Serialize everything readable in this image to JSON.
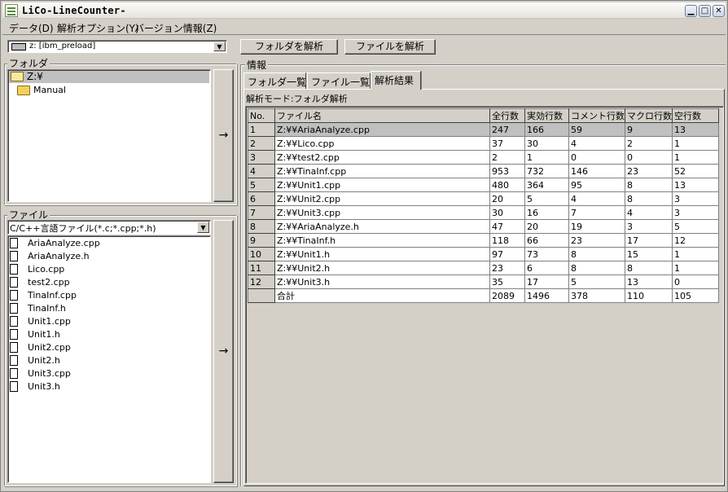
{
  "window": {
    "title": "LiCo-LineCounter-",
    "buttons": {
      "minimize": "▁",
      "maximize": "□",
      "close": "✕"
    }
  },
  "menu": [
    "データ(D)",
    "解析オプション(Y)",
    "バージョン情報(Z)"
  ],
  "drive": {
    "selected": "z: [ibm_preload]"
  },
  "actions": {
    "analyze_folder": "フォルダを解析",
    "analyze_file": "ファイルを解析",
    "move_arrow": "→"
  },
  "folder_panel": {
    "label": "フォルダ",
    "items": [
      "Z:¥",
      "Manual"
    ]
  },
  "file_panel": {
    "label": "ファイル",
    "filter": "C/C++言語ファイル(*.c;*.cpp;*.h)",
    "files": [
      "AriaAnalyze.cpp",
      "AriaAnalyze.h",
      "Lico.cpp",
      "test2.cpp",
      "TinaInf.cpp",
      "TinaInf.h",
      "Unit1.cpp",
      "Unit1.h",
      "Unit2.cpp",
      "Unit2.h",
      "Unit3.cpp",
      "Unit3.h"
    ]
  },
  "info": {
    "label": "情報",
    "tabs": [
      "フォルダ一覧",
      "ファイル一覧",
      "解析結果"
    ],
    "active_tab": 2,
    "mode_label": "解析モード:フォルダ解析"
  },
  "results": {
    "columns": [
      "No.",
      "ファイル名",
      "全行数",
      "実効行数",
      "コメント行数",
      "マクロ行数",
      "空行数"
    ],
    "rows": [
      [
        "1",
        "Z:¥¥AriaAnalyze.cpp",
        "247",
        "166",
        "59",
        "9",
        "13"
      ],
      [
        "2",
        "Z:¥¥Lico.cpp",
        "37",
        "30",
        "4",
        "2",
        "1"
      ],
      [
        "3",
        "Z:¥¥test2.cpp",
        "2",
        "1",
        "0",
        "0",
        "1"
      ],
      [
        "4",
        "Z:¥¥TinaInf.cpp",
        "953",
        "732",
        "146",
        "23",
        "52"
      ],
      [
        "5",
        "Z:¥¥Unit1.cpp",
        "480",
        "364",
        "95",
        "8",
        "13"
      ],
      [
        "6",
        "Z:¥¥Unit2.cpp",
        "20",
        "5",
        "4",
        "8",
        "3"
      ],
      [
        "7",
        "Z:¥¥Unit3.cpp",
        "30",
        "16",
        "7",
        "4",
        "3"
      ],
      [
        "8",
        "Z:¥¥AriaAnalyze.h",
        "47",
        "20",
        "19",
        "3",
        "5"
      ],
      [
        "9",
        "Z:¥¥TinaInf.h",
        "118",
        "66",
        "23",
        "17",
        "12"
      ],
      [
        "10",
        "Z:¥¥Unit1.h",
        "97",
        "73",
        "8",
        "15",
        "1"
      ],
      [
        "11",
        "Z:¥¥Unit2.h",
        "23",
        "6",
        "8",
        "8",
        "1"
      ],
      [
        "12",
        "Z:¥¥Unit3.h",
        "35",
        "17",
        "5",
        "13",
        "0"
      ]
    ],
    "total": [
      "",
      "合計",
      "2089",
      "1496",
      "378",
      "110",
      "105"
    ],
    "selected_row": 0
  }
}
